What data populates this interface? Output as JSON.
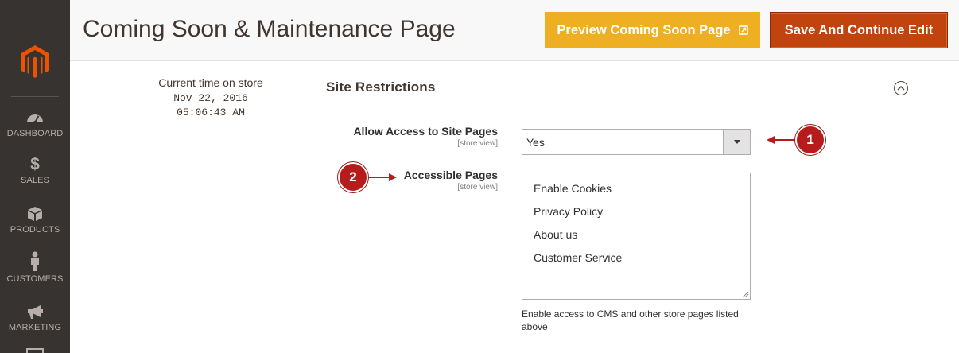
{
  "sidebar": {
    "items": [
      {
        "label": "DASHBOARD",
        "icon": "dashboard-icon"
      },
      {
        "label": "SALES",
        "icon": "dollar-icon"
      },
      {
        "label": "PRODUCTS",
        "icon": "box-icon"
      },
      {
        "label": "CUSTOMERS",
        "icon": "person-icon"
      },
      {
        "label": "MARKETING",
        "icon": "megaphone-icon"
      }
    ]
  },
  "header": {
    "title": "Coming Soon & Maintenance Page",
    "preview_label": "Preview Coming Soon Page",
    "save_label": "Save And Continue Edit"
  },
  "store_time": {
    "label": "Current time on store",
    "date": "Nov 22, 2016",
    "time": "05:06:43 AM"
  },
  "section": {
    "title": "Site Restrictions",
    "fields": [
      {
        "label": "Allow Access to Site Pages",
        "scope": "[store view]",
        "value": "Yes"
      },
      {
        "label": "Accessible Pages",
        "scope": "[store view]",
        "options": [
          "Enable Cookies",
          "Privacy Policy",
          "About us",
          "Customer Service"
        ],
        "note": "Enable access to CMS and other store pages listed above"
      }
    ]
  },
  "callouts": {
    "one": "1",
    "two": "2"
  },
  "colors": {
    "sidebar_bg": "#373330",
    "preview_button": "#eeaf22",
    "save_button": "#c1440e",
    "brand_logo": "#eb5202",
    "callout_badge": "#b71c1c"
  }
}
